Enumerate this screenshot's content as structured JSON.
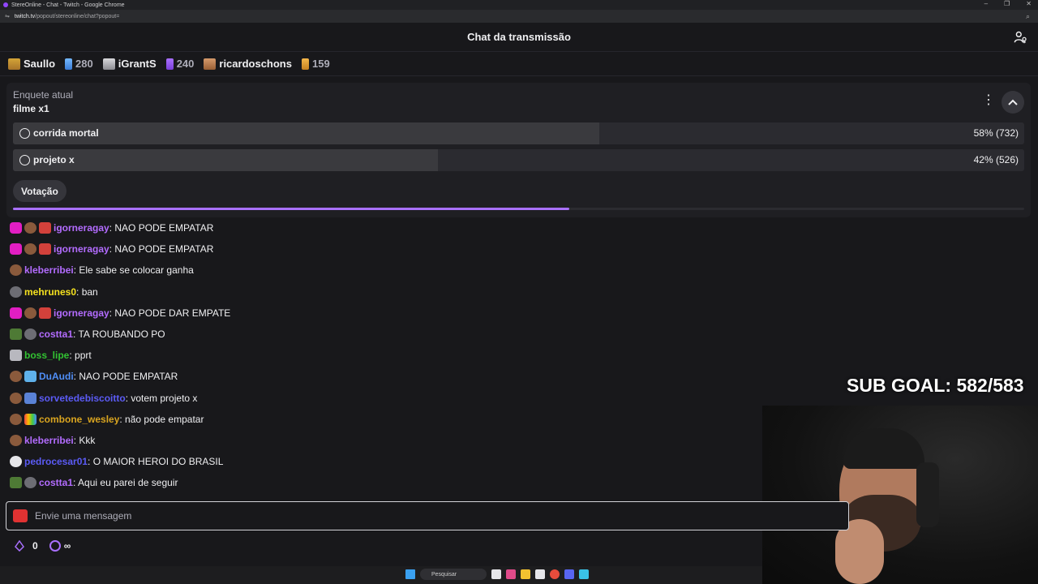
{
  "window": {
    "title": "StereOnline - Chat - Twitch - Google Chrome",
    "url_domain": "twitch.tv",
    "url_path": "/popout/stereonline/chat?popout="
  },
  "header": {
    "title": "Chat da transmissão"
  },
  "leaderboard": [
    {
      "name": "Saullo",
      "count": "280"
    },
    {
      "name": "iGrantS",
      "count": "240"
    },
    {
      "name": "ricardoschons",
      "count": "159"
    }
  ],
  "poll": {
    "label": "Enquete atual",
    "title": "filme x1",
    "options": [
      {
        "name": "corrida mortal",
        "result": "58% (732)",
        "fraction": 0.58
      },
      {
        "name": "projeto x",
        "result": "42% (526)",
        "fraction": 0.42
      }
    ],
    "vote_label": "Votação",
    "time_progress": 0.55
  },
  "messages": [
    {
      "user": "igorneragay",
      "color": "#b36cff",
      "text": ": NAO PODE EMPATAR"
    },
    {
      "user": "igorneragay",
      "color": "#b36cff",
      "text": ": NAO PODE EMPATAR"
    },
    {
      "user": "kleberribei",
      "color": "#b36cff",
      "text": ": Ele sabe se colocar ganha"
    },
    {
      "user": "mehrunes0",
      "color": "#f6e21f",
      "text": ": ban"
    },
    {
      "user": "igorneragay",
      "color": "#b36cff",
      "text": ": NAO PODE DAR EMPATE"
    },
    {
      "user": "costta1",
      "color": "#b36cff",
      "text": ": TA ROUBANDO PO"
    },
    {
      "user": "boss_lipe",
      "color": "#32c232",
      "text": ": pprt"
    },
    {
      "user": "DuAudi",
      "color": "#4f8ef7",
      "text": ": NAO PODE EMPATAR"
    },
    {
      "user": "sorvetedebiscoitto",
      "color": "#5b5bf5",
      "text": ": votem projeto x"
    },
    {
      "user": "combone_wesley",
      "color": "#daa520",
      "text": ": não pode empatar"
    },
    {
      "user": "kleberribei",
      "color": "#b36cff",
      "text": ": Kkk"
    },
    {
      "user": "pedrocesar01",
      "color": "#5b5bf5",
      "text": ": O MAIOR HEROI DO BRASIL"
    },
    {
      "user": "costta1",
      "color": "#b36cff",
      "text": ": Aqui eu parei de seguir"
    }
  ],
  "overlay": {
    "sub_goal": "SUB GOAL: 582/583"
  },
  "input": {
    "placeholder": "Envie uma mensagem"
  },
  "footer": {
    "points": "0",
    "infinity": "∞"
  },
  "taskbar": {
    "search_label": "Pesquisar"
  }
}
